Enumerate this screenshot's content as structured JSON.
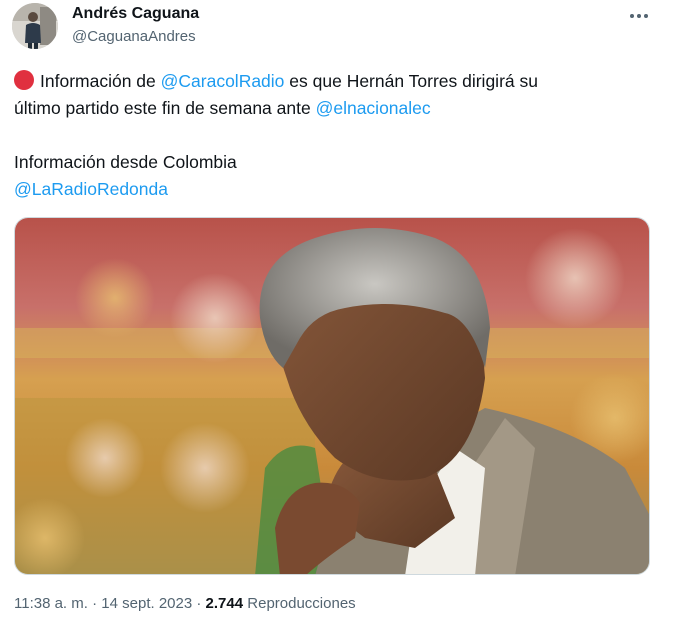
{
  "author": {
    "name": "Andrés Caguana",
    "handle": "@CaguanaAndres"
  },
  "header": {
    "more_icon": "more-horizontal-icon"
  },
  "tweet": {
    "bullet_icon": "red-circle-icon",
    "bullet_color": "#e0303f",
    "line1_pre": "Información de ",
    "line1_mention": "@CaracolRadio",
    "line1_post": " es que Hernán Torres dirigirá su",
    "line2_pre": "último partido este fin de semana ante ",
    "line2_mention": "@elnacionalec",
    "line3": "Información desde Colombia",
    "line4_mention": "@LaRadioRedonda"
  },
  "media": {
    "icon": "photo-of-man-icon"
  },
  "meta": {
    "time": "11:38 a. m.",
    "separator": " · ",
    "date": "14 sept. 2023",
    "views_count": "2.744",
    "views_label": "Reproducciones"
  },
  "colors": {
    "link": "#1d9bf0",
    "secondary_text": "#536471",
    "primary_text": "#0f1419"
  }
}
